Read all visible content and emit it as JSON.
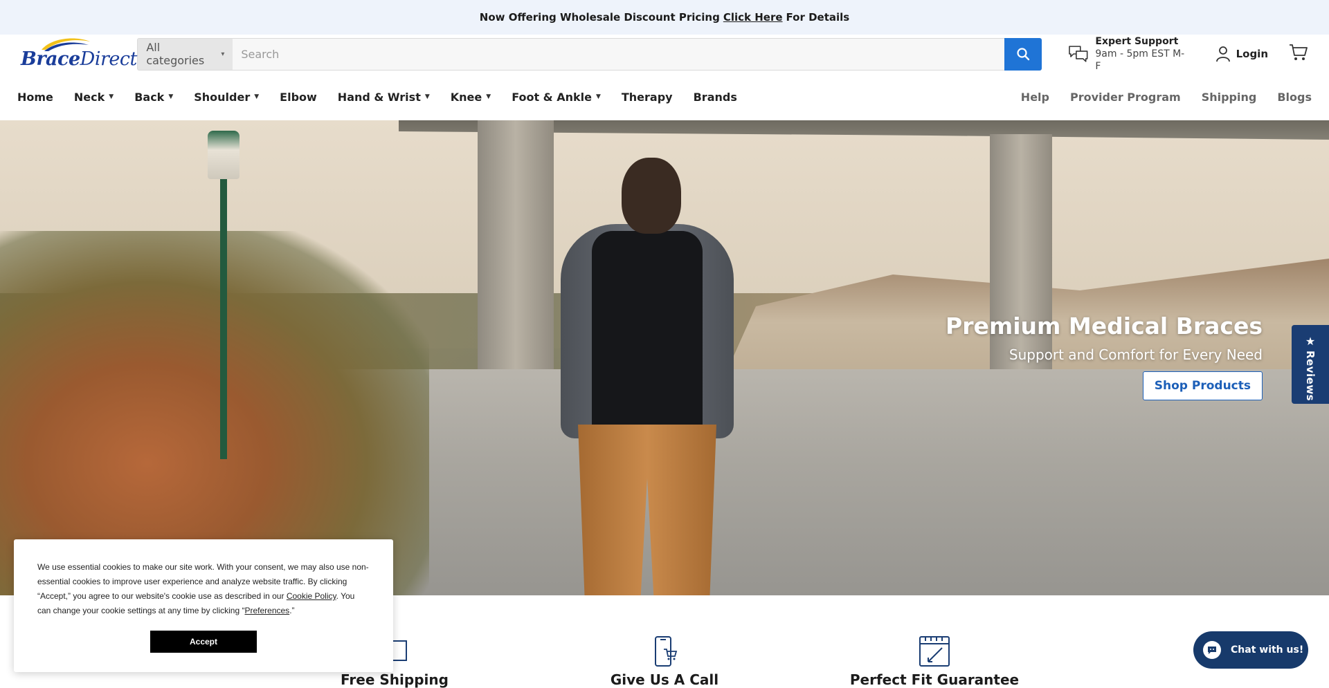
{
  "announcement": {
    "before": "Now Offering Wholesale Discount Pricing",
    "link": "Click Here",
    "after": "For Details"
  },
  "logo": {
    "word1": "Brace",
    "word2": "Direct"
  },
  "search": {
    "category": "All categories",
    "placeholder": "Search",
    "icon": "search-icon"
  },
  "support": {
    "title": "Expert Support",
    "hours": "9am - 5pm EST M-F",
    "icon": "chat-bubbles-icon"
  },
  "login": {
    "label": "Login",
    "icon": "user-icon"
  },
  "cart": {
    "icon": "cart-icon"
  },
  "nav": {
    "left": [
      {
        "label": "Home",
        "dropdown": false
      },
      {
        "label": "Neck",
        "dropdown": true
      },
      {
        "label": "Back",
        "dropdown": true
      },
      {
        "label": "Shoulder",
        "dropdown": true
      },
      {
        "label": "Elbow",
        "dropdown": false
      },
      {
        "label": "Hand & Wrist",
        "dropdown": true
      },
      {
        "label": "Knee",
        "dropdown": true
      },
      {
        "label": "Foot & Ankle",
        "dropdown": true
      },
      {
        "label": "Therapy",
        "dropdown": false
      },
      {
        "label": "Brands",
        "dropdown": false
      }
    ],
    "right": [
      "Help",
      "Provider Program",
      "Shipping",
      "Blogs"
    ]
  },
  "hero": {
    "title": "Premium Medical Braces",
    "subtitle": "Support and Comfort for Every Need",
    "button": "Shop Products"
  },
  "reviews_tab": {
    "label": "Reviews",
    "icon": "star-icon"
  },
  "features": [
    {
      "title": "Free Shipping",
      "icon": "truck-icon"
    },
    {
      "title": "Give Us A Call",
      "icon": "phone-cart-icon"
    },
    {
      "title": "Perfect Fit Guarantee",
      "icon": "measure-icon"
    }
  ],
  "cookie": {
    "text_1": "We use essential cookies to make our site work. With your consent, we may also use non-essential cookies to improve user experience and analyze website traffic. By clicking “Accept,” you agree to our website's cookie use as described in our ",
    "policy_link": "Cookie Policy",
    "text_2": ". You can change your cookie settings at any time by clicking “",
    "prefs_link": "Preferences",
    "text_3": ".”",
    "accept": "Accept"
  },
  "chat": {
    "label": "Chat with us!",
    "icon": "chat-icon"
  },
  "colors": {
    "accent": "#1f74d6",
    "navy": "#173a6b",
    "announce_bg": "#eef3fb"
  }
}
